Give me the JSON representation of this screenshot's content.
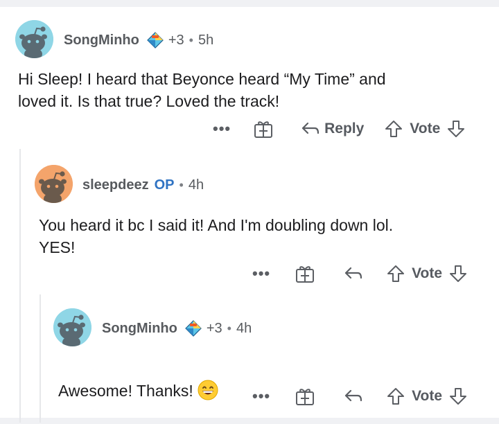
{
  "comments": [
    {
      "username": "SongMinho",
      "karma": "+3",
      "separator": "•",
      "time": "5h",
      "body": "Hi Sleep! I heard that Beyonce heard “My Time” and\nloved it. Is that true? Loved the track!",
      "more": "•••",
      "reply_label": "Reply",
      "vote_label": "Vote",
      "avatar_bg": "#8fd6e6"
    },
    {
      "username": "sleepdeez",
      "op_label": "OP",
      "separator": "•",
      "time": "4h",
      "body": "You heard it bc I said it! And I'm doubling down lol.\nYES!",
      "more": "•••",
      "vote_label": "Vote",
      "avatar_bg": "#f4a46b"
    },
    {
      "username": "SongMinho",
      "karma": "+3",
      "separator": "•",
      "time": "4h",
      "body": "Awesome! Thanks!",
      "emoji": "grinning-smiling-eyes",
      "more": "•••",
      "vote_label": "Vote",
      "avatar_bg": "#8fd6e6"
    }
  ],
  "colors": {
    "op_blue": "#2f73c3",
    "meta_gray": "#575a5e",
    "thread_line": "#e6e7ea",
    "band": "#f0f1f4"
  }
}
